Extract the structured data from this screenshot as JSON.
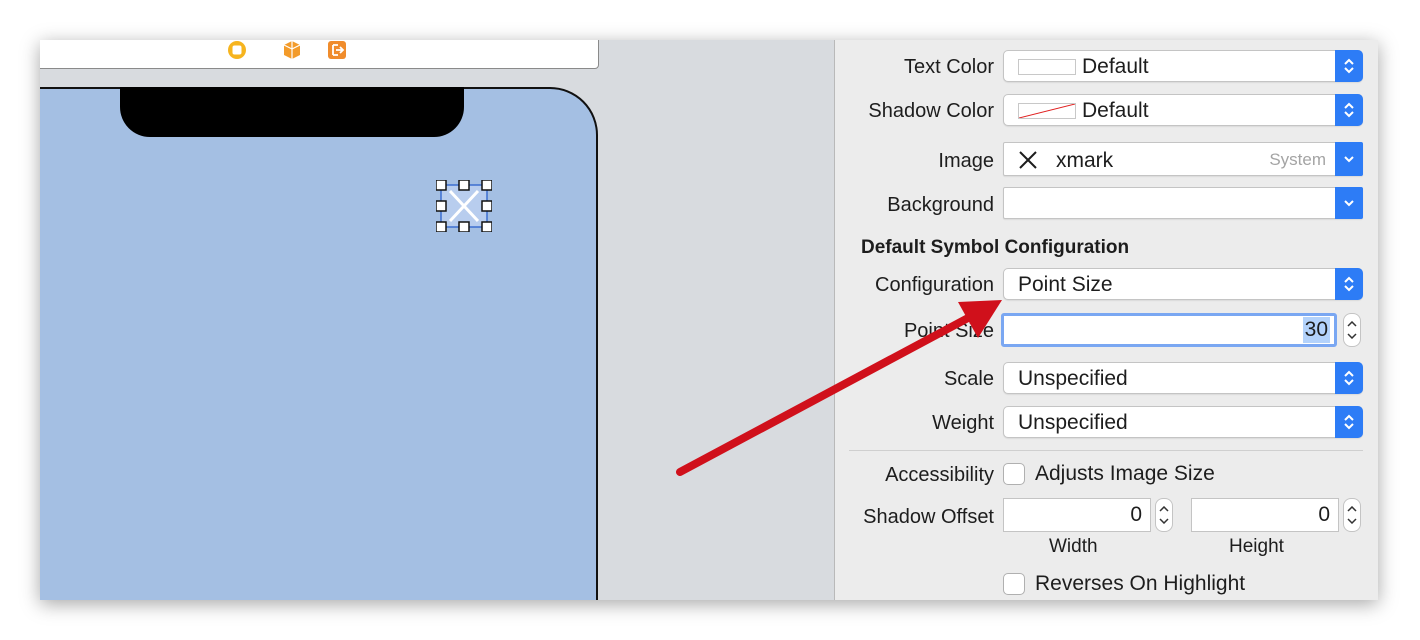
{
  "inspector": {
    "text_color": {
      "label": "Text Color",
      "value": "Default"
    },
    "shadow_color": {
      "label": "Shadow Color",
      "value": "Default"
    },
    "image": {
      "label": "Image",
      "value": "xmark",
      "source": "System"
    },
    "background": {
      "label": "Background",
      "value": ""
    },
    "symbol_section_title": "Default Symbol Configuration",
    "configuration": {
      "label": "Configuration",
      "value": "Point Size"
    },
    "point_size": {
      "label": "Point Size",
      "value": "30"
    },
    "scale": {
      "label": "Scale",
      "value": "Unspecified"
    },
    "weight": {
      "label": "Weight",
      "value": "Unspecified"
    },
    "accessibility": {
      "label": "Accessibility",
      "checkbox_label": "Adjusts Image Size",
      "checked": false
    },
    "shadow_offset": {
      "label": "Shadow Offset",
      "width_value": "0",
      "height_value": "0",
      "width_label": "Width",
      "height_label": "Height"
    },
    "reverses_on_highlight": {
      "checkbox_label": "Reverses On Highlight",
      "checked": false
    }
  },
  "canvas": {
    "scene_dock_icons": [
      "view-controller-icon",
      "first-responder-icon",
      "exit-icon"
    ],
    "selected_image_icon": "xmark-icon"
  },
  "colors": {
    "accent": "#2d7cf6",
    "device_background": "#a4bfe3",
    "annotation_arrow": "#d0101b",
    "dock_orange": "#f6a21e"
  }
}
